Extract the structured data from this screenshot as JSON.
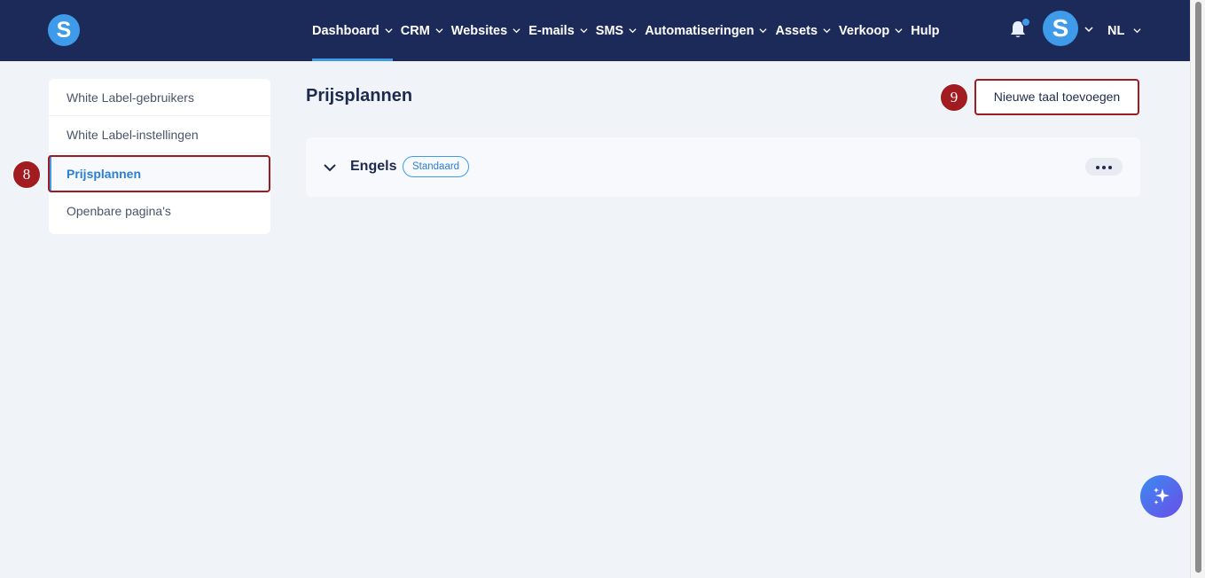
{
  "brand": {
    "logo_letter": "S",
    "colors": {
      "nav_bg": "#1c2a5a",
      "accent": "#3f9bea",
      "marker": "#a11b20"
    }
  },
  "nav": {
    "items": [
      {
        "label": "Dashboard",
        "dropdown": true,
        "active": true
      },
      {
        "label": "CRM",
        "dropdown": true
      },
      {
        "label": "Websites",
        "dropdown": true
      },
      {
        "label": "E-mails",
        "dropdown": true
      },
      {
        "label": "SMS",
        "dropdown": true
      },
      {
        "label": "Automatiseringen",
        "dropdown": true
      },
      {
        "label": "Assets",
        "dropdown": true
      },
      {
        "label": "Verkoop",
        "dropdown": true
      },
      {
        "label": "Hulp",
        "dropdown": false
      }
    ],
    "avatar_letter": "S",
    "language": "NL",
    "icons": {
      "notifications": "bell-icon",
      "dropdown": "chevron-down-icon"
    }
  },
  "sidebar": {
    "items": [
      {
        "label": "White Label-gebruikers"
      },
      {
        "label": "White Label-instellingen"
      },
      {
        "label": "Prijsplannen",
        "active": true
      },
      {
        "label": "Openbare pagina's"
      }
    ]
  },
  "main": {
    "title": "Prijsplannen",
    "add_button_label": "Nieuwe taal toevoegen",
    "languages": [
      {
        "name": "Engels",
        "badge": "Standaard"
      }
    ]
  },
  "annotations": {
    "marker_8": "8",
    "marker_9": "9"
  },
  "ai_assistant": {
    "icon": "sparkles-icon"
  }
}
